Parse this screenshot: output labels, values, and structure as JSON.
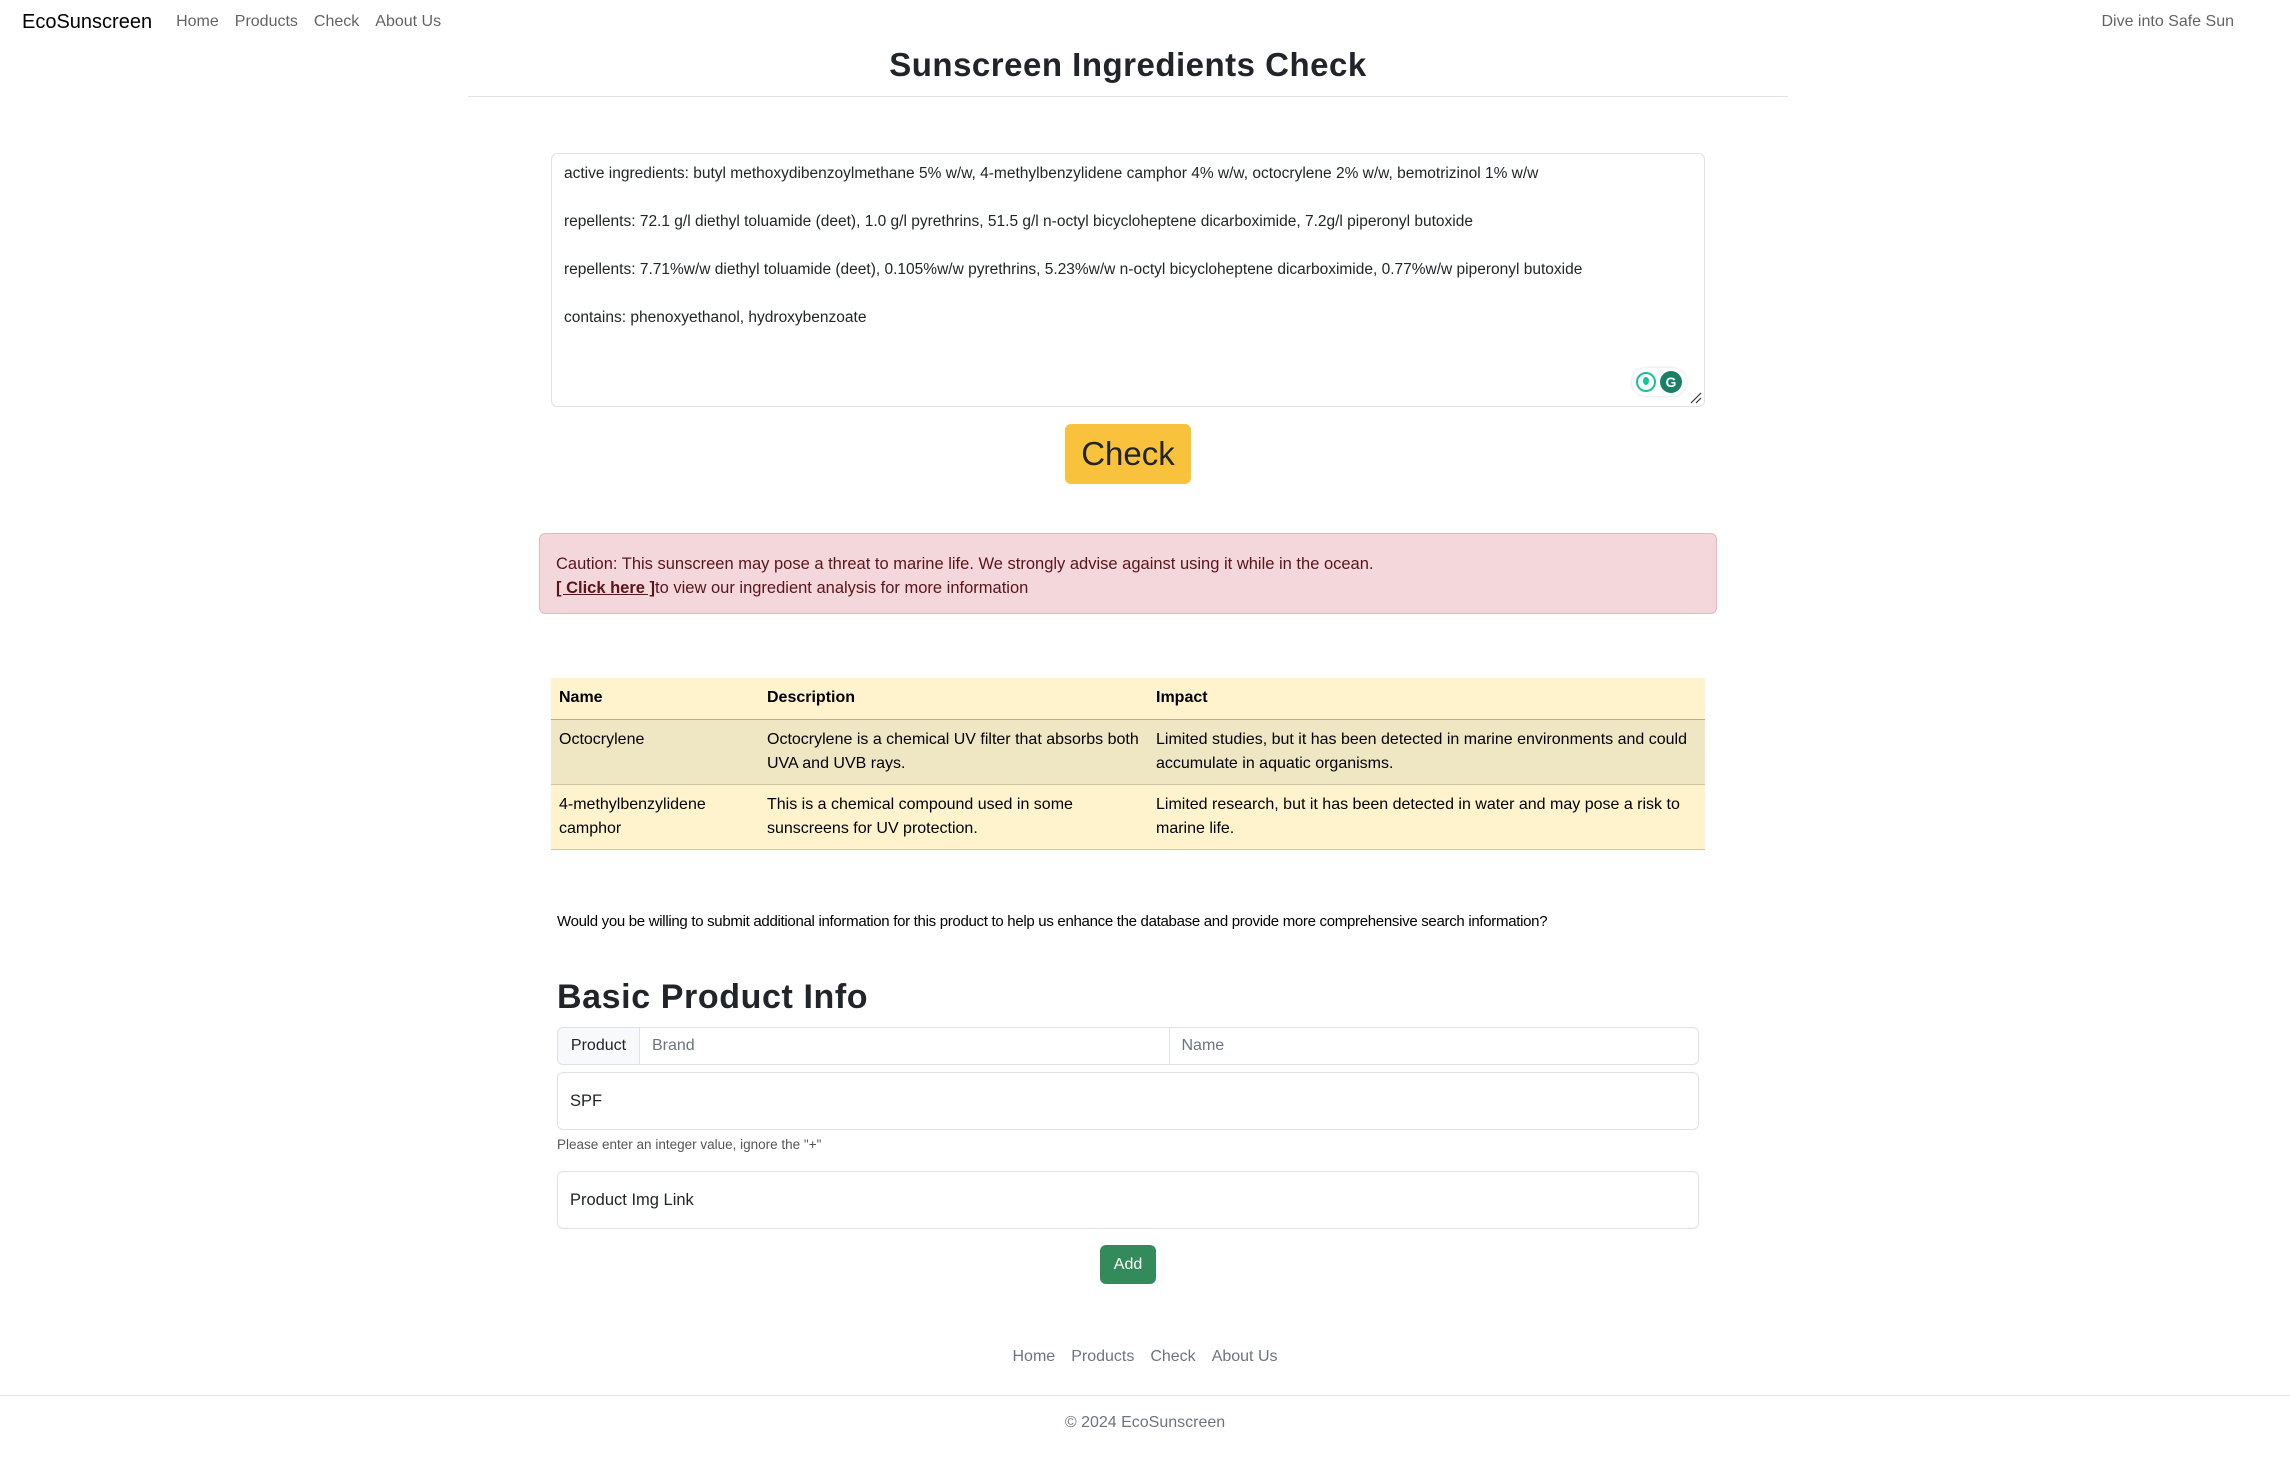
{
  "navbar": {
    "brand": "EcoSunscreen",
    "links": [
      "Home",
      "Products",
      "Check",
      "About Us"
    ],
    "tagline": "Dive into Safe Sun"
  },
  "page_title": "Sunscreen Ingredients Check",
  "ingredients_input": {
    "lines": [
      "active ingredients: butyl methoxydibenzoylmethane 5% w/w, 4-methylbenzylidene camphor 4% w/w, octocrylene 2% w/w, bemotrizinol 1% w/w",
      "repellents: 72.1 g/l diethyl toluamide (deet), 1.0 g/l pyrethrins, 51.5 g/l n-octyl bicycloheptene dicarboximide, 7.2g/l piperonyl butoxide",
      "repellents: 7.71%w/w diethyl toluamide (deet), 0.105%w/w pyrethrins, 5.23%w/w n-octyl bicycloheptene dicarboximide, 0.77%w/w piperonyl butoxide",
      "contains: phenoxyethanol, hydroxybenzoate"
    ]
  },
  "check_button": "Check",
  "alert": {
    "message": "Caution: This sunscreen may pose a threat to marine life. We strongly advise against using it while in the ocean.",
    "link_text": "[ Click here ]",
    "link_suffix": "to view our ingredient analysis for more information"
  },
  "ingredient_table": {
    "headers": [
      "Name",
      "Description",
      "Impact"
    ],
    "rows": [
      {
        "name": "Octocrylene",
        "description": "Octocrylene is a chemical UV filter that absorbs both UVA and UVB rays.",
        "impact": "Limited studies, but it has been detected in marine environments and could accumulate in aquatic organisms."
      },
      {
        "name": "4-methylbenzylidene camphor",
        "description": "This is a chemical compound used in some sunscreens for UV protection.",
        "impact": "Limited research, but it has been detected in water and may pose a risk to marine life."
      }
    ]
  },
  "submit_prompt": "Would you be willing to submit additional information for this product to help us enhance the database and provide more comprehensive search information?",
  "form": {
    "heading": "Basic Product Info",
    "product_addon": "Product",
    "brand_placeholder": "Brand",
    "name_placeholder": "Name",
    "spf_label": "SPF",
    "spf_help": "Please enter an integer value, ignore the \"+\"",
    "img_label": "Product Img Link",
    "add_button": "Add"
  },
  "footer": {
    "links": [
      "Home",
      "Products",
      "Check",
      "About Us"
    ],
    "copyright": "© 2024 EcoSunscreen"
  },
  "colors": {
    "check_button": "#f9c23c",
    "alert_bg": "#f4d7da",
    "table_bg": "#fff3cd",
    "add_button": "#338a5a"
  }
}
